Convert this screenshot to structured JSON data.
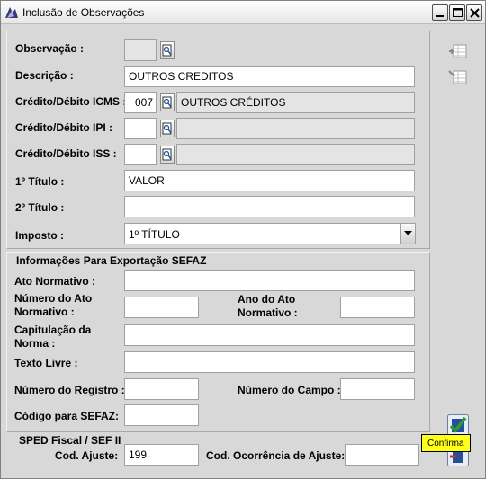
{
  "window": {
    "title": "Inclusão de Observações",
    "icon": "app-icon"
  },
  "form": {
    "observacao": {
      "label": "Observação :",
      "value": ""
    },
    "descricao": {
      "label": "Descrição :",
      "value": "OUTROS CREDITOS"
    },
    "icms": {
      "label": "Crédito/Débito ICMS :",
      "code": "007",
      "description": "OUTROS CRÉDITOS"
    },
    "ipi": {
      "label": "Crédito/Débito IPI :",
      "code": "",
      "description": ""
    },
    "iss": {
      "label": "Crédito/Débito ISS :",
      "code": "",
      "description": ""
    },
    "titulo1": {
      "label": "1º Título :",
      "value": "VALOR"
    },
    "titulo2": {
      "label": "2º Título :",
      "value": ""
    },
    "imposto": {
      "label": "Imposto :",
      "selected": "1º TÍTULO"
    }
  },
  "sefaz": {
    "title": "Informações Para Exportação SEFAZ",
    "ato_normativo": {
      "label": "Ato Normativo :",
      "value": ""
    },
    "numero_ato": {
      "label": "Número do Ato Normativo :",
      "value": ""
    },
    "ano_ato": {
      "label": "Ano do Ato Normativo :",
      "value": ""
    },
    "capitulacao": {
      "label": "Capitulação da Norma :",
      "value": ""
    },
    "texto_livre": {
      "label": "Texto Livre :",
      "value": ""
    },
    "numero_registro": {
      "label": "Número do Registro :",
      "value": ""
    },
    "numero_campo": {
      "label": "Número do Campo :",
      "value": ""
    },
    "codigo_sefaz": {
      "label": "Código para SEFAZ:",
      "value": ""
    }
  },
  "sped": {
    "title": "SPED Fiscal / SEF II",
    "cod_ajuste": {
      "label": "Cod. Ajuste:",
      "value": "199"
    },
    "cod_ocorrencia": {
      "label": "Cod. Ocorrência de Ajuste:",
      "value": ""
    }
  },
  "tooltip": {
    "text": "Confirma"
  },
  "colors": {
    "tooltip_bg": "#ffff1a",
    "confirm_green": "#2e9a2e",
    "readonly_field": "#e4e4e4"
  }
}
